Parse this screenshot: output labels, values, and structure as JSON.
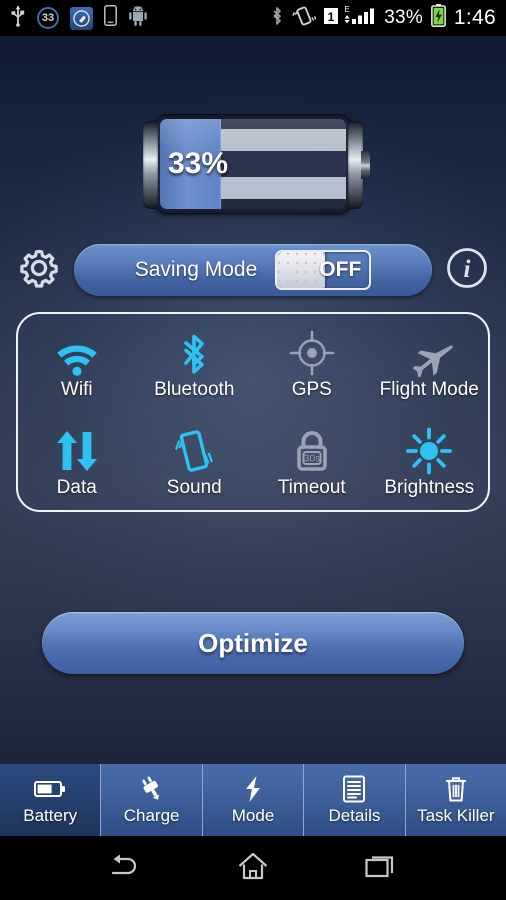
{
  "status_bar": {
    "left_icons": [
      {
        "name": "usb-icon",
        "label": "USB"
      },
      {
        "name": "battery-percent-circle-icon",
        "label": "33"
      },
      {
        "name": "cleaner-app-icon",
        "label": "Cleaner"
      },
      {
        "name": "phone-icon",
        "label": "Phone"
      },
      {
        "name": "android-robot-icon",
        "label": "Android"
      }
    ],
    "right_icons": [
      {
        "name": "bluetooth-icon",
        "label": "Bluetooth"
      },
      {
        "name": "vibrate-icon",
        "label": "Vibrate"
      },
      {
        "name": "sim-signal-icon",
        "label": "SIM 1 E"
      }
    ],
    "sim_number": "1",
    "network_type": "E",
    "battery_text": "33%",
    "charging_icon": "charging-battery-icon",
    "clock": "1:46"
  },
  "battery_widget": {
    "percent_label": "33%",
    "percent_value": 33,
    "fill_color": "#6e90cf",
    "body_color": "#262f45",
    "stripe_color": "#b6bfcc"
  },
  "saving_mode": {
    "settings_icon": "gear-icon",
    "label": "Saving Mode",
    "toggle_state": "OFF",
    "info_icon": "info-icon"
  },
  "toggles": [
    {
      "id": "wifi",
      "label": "Wifi",
      "icon": "wifi-icon",
      "active": true,
      "color": "#2ec2f2"
    },
    {
      "id": "bluetooth",
      "label": "Bluetooth",
      "icon": "bluetooth-icon",
      "active": true,
      "color": "#2ec2f2"
    },
    {
      "id": "gps",
      "label": "GPS",
      "icon": "gps-icon",
      "active": false,
      "color": "#9aa3b4"
    },
    {
      "id": "flight",
      "label": "Flight Mode",
      "icon": "airplane-icon",
      "active": false,
      "color": "#9aa3b4"
    },
    {
      "id": "data",
      "label": "Data",
      "icon": "data-arrows-icon",
      "active": true,
      "color": "#2ec2f2"
    },
    {
      "id": "sound",
      "label": "Sound",
      "icon": "vibrate-icon",
      "active": true,
      "color": "#2ec2f2"
    },
    {
      "id": "timeout",
      "label": "Timeout",
      "icon": "lock-icon",
      "active": false,
      "color": "#9aa3b4",
      "value": "30s"
    },
    {
      "id": "brightness",
      "label": "Brightness",
      "icon": "sun-icon",
      "active": true,
      "color": "#2ec2f2"
    }
  ],
  "optimize_button": {
    "label": "Optimize"
  },
  "tabs": [
    {
      "id": "battery",
      "label": "Battery",
      "icon": "battery-icon",
      "active": true
    },
    {
      "id": "charge",
      "label": "Charge",
      "icon": "plug-icon",
      "active": false
    },
    {
      "id": "mode",
      "label": "Mode",
      "icon": "lightning-icon",
      "active": false
    },
    {
      "id": "details",
      "label": "Details",
      "icon": "document-icon",
      "active": false
    },
    {
      "id": "task_killer",
      "label": "Task Killer",
      "icon": "trash-icon",
      "active": false
    }
  ],
  "nav_bar": [
    {
      "id": "back",
      "icon": "back-arrow-icon"
    },
    {
      "id": "home",
      "icon": "home-icon"
    },
    {
      "id": "recent",
      "icon": "recent-apps-icon"
    }
  ]
}
